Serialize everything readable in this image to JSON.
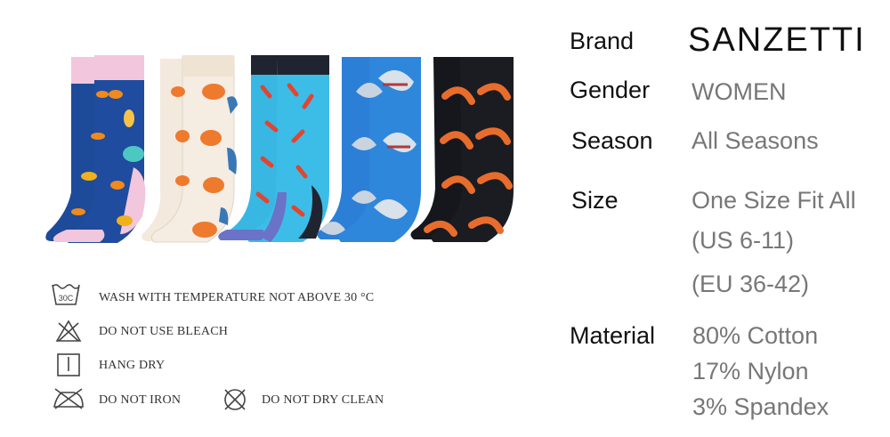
{
  "specs": {
    "brand_label": "Brand",
    "brand_value": "SANZETTI",
    "gender_label": "Gender",
    "gender_value": "WOMEN",
    "season_label": "Season",
    "season_value": "All Seasons",
    "size_label": "Size",
    "size_values": [
      "One Size Fit All",
      "(US 6-11)",
      "(EU 36-42)"
    ],
    "material_label": "Material",
    "material_values": [
      "80% Cotton",
      "17% Nylon",
      "3%  Spandex"
    ]
  },
  "care": {
    "wash_icon_text": "30C",
    "wash": "WASH WITH TEMPERATURE NOT ABOVE 30 °C",
    "bleach": "DO NOT USE BLEACH",
    "hang": "HANG DRY",
    "iron": "DO NOT IRON",
    "dryclean": "DO NOT DRY CLEAN"
  },
  "products": [
    {
      "pattern": "tropical-fish",
      "body": "#1e4a9a",
      "cuff": "#f2c6dc"
    },
    {
      "pattern": "salmon-sushi",
      "body": "#f3e9dd",
      "cuff": "#efe3d4"
    },
    {
      "pattern": "crayfish",
      "body": "#38b7e3",
      "cuff": "#1f2430"
    },
    {
      "pattern": "shark",
      "body": "#2c7fd6",
      "cuff": "#2c7fd6"
    },
    {
      "pattern": "shrimp",
      "body": "#15171c",
      "cuff": "#15171c"
    }
  ]
}
